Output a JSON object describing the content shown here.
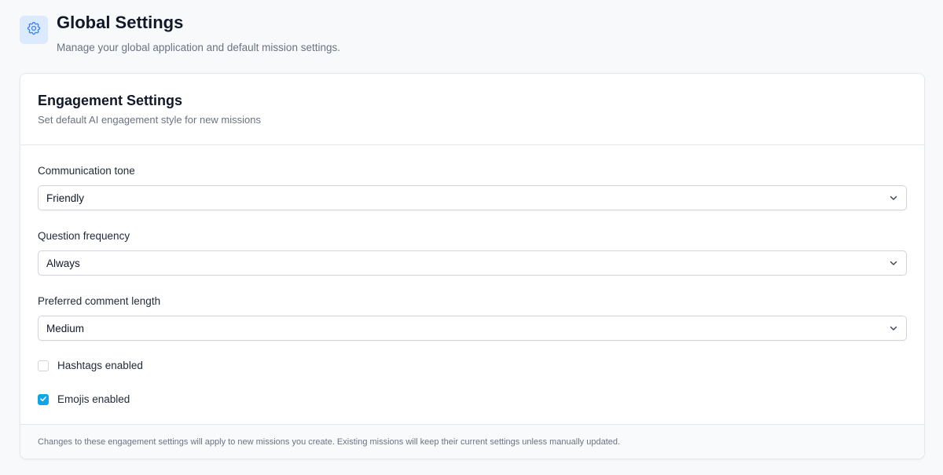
{
  "header": {
    "title": "Global Settings",
    "subtitle": "Manage your global application and default mission settings.",
    "icon": "gear-icon",
    "accent": "#3b82f6"
  },
  "card": {
    "title": "Engagement Settings",
    "subtitle": "Set default AI engagement style for new missions",
    "fields": [
      {
        "label": "Communication tone",
        "value": "Friendly"
      },
      {
        "label": "Question frequency",
        "value": "Always"
      },
      {
        "label": "Preferred comment length",
        "value": "Medium"
      }
    ],
    "checkboxes": [
      {
        "label": "Hashtags enabled",
        "checked": false
      },
      {
        "label": "Emojis enabled",
        "checked": true
      }
    ],
    "checkbox_color": "#0ea5e9",
    "footer_note": "Changes to these engagement settings will apply to new missions you create. Existing missions will keep their current settings unless manually updated."
  }
}
